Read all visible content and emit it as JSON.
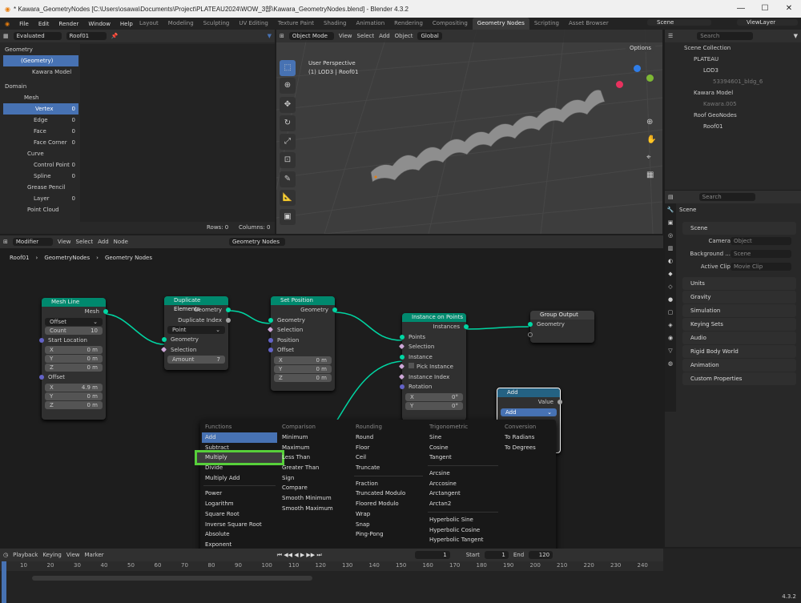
{
  "window": {
    "title": "* Kawara_GeometryNodes [C:\\Users\\osawa\\Documents\\Project\\PLATEAU2024\\WOW_3部\\Kawara_GeometryNodes.blend] - Blender 4.3.2"
  },
  "menubar": {
    "items": [
      "File",
      "Edit",
      "Render",
      "Window",
      "Help"
    ],
    "tabs": [
      "Layout",
      "Modeling",
      "Sculpting",
      "UV Editing",
      "Texture Paint",
      "Shading",
      "Animation",
      "Rendering",
      "Compositing",
      "Geometry Nodes",
      "Scripting",
      "Asset Browser"
    ],
    "scene": "Scene",
    "viewlayer": "ViewLayer"
  },
  "spreadsheet": {
    "mode": "Evaluated",
    "object": "Roof01",
    "geometry_header": "Geometry",
    "geometry": "(Geometry)",
    "kawara": "Kawara Model",
    "domain_header": "Domain",
    "mesh": "Mesh",
    "vertex": "Vertex",
    "edge": "Edge",
    "face": "Face",
    "face_corner": "Face Corner",
    "curve": "Curve",
    "control_point": "Control Point",
    "spline": "Spline",
    "grease": "Grease Pencil",
    "layer": "Layer",
    "pointcloud": "Point Cloud",
    "zero": "0",
    "rows": "Rows: 0",
    "cols": "Columns: 0"
  },
  "viewport": {
    "mode": "Object Mode",
    "menus": [
      "View",
      "Select",
      "Add",
      "Object"
    ],
    "transform": "Global",
    "options": "Options",
    "persp": "User Perspective",
    "sub": "(1) LOD3 | Roof01"
  },
  "outliner": {
    "search": "Search",
    "collection": "Scene Collection",
    "plateau": "PLATEAU",
    "lod3": "LOD3",
    "bldg": "53394601_bldg_6",
    "kawara": "Kawara Model",
    "kawara005": "Kawara.005",
    "roofgeo": "Roof GeoNodes",
    "roof01": "Roof01"
  },
  "props": {
    "search": "Search",
    "title": "Scene",
    "section": "Scene",
    "camera_label": "Camera",
    "camera": "Object",
    "bg_label": "Background ...",
    "bg": "Scene",
    "clip_label": "Active Clip",
    "clip": "Movie Clip",
    "panels": [
      "Units",
      "Gravity",
      "Simulation",
      "Keying Sets",
      "Audio",
      "Rigid Body World",
      "Animation",
      "Custom Properties"
    ]
  },
  "node_editor": {
    "mode": "Modifier",
    "menus": [
      "View",
      "Select",
      "Add",
      "Node"
    ],
    "tree": "Geometry Nodes",
    "bc1": "Roof01",
    "bc2": "GeometryNodes",
    "bc3": "Geometry Nodes"
  },
  "nodes": {
    "meshline": {
      "title": "Mesh Line",
      "out": "Mesh",
      "mode": "Offset",
      "count_l": "Count",
      "count": "10",
      "start": "Start Location",
      "x": "X",
      "y": "Y",
      "z": "Z",
      "zm": "0 m",
      "offset": "Offset",
      "ox": "4.9 m"
    },
    "dup": {
      "title": "Duplicate Elements",
      "geo": "Geometry",
      "idx": "Duplicate Index",
      "domain": "Point",
      "sel": "Selection",
      "amt_l": "Amount",
      "amt": "7"
    },
    "setpos": {
      "title": "Set Position",
      "geo": "Geometry",
      "sel": "Selection",
      "pos": "Position",
      "off": "Offset",
      "zm": "0 m"
    },
    "inst": {
      "title": "Instance on Points",
      "out": "Instances",
      "pts": "Points",
      "sel": "Selection",
      "inst": "Instance",
      "pick": "Pick Instance",
      "idx": "Instance Index",
      "rot": "Rotation",
      "deg": "0°",
      "x": "X",
      "y": "Y"
    },
    "group": {
      "title": "Group Output",
      "geo": "Geometry"
    },
    "add": {
      "title": "Add",
      "value": "Value",
      "op": "Add"
    }
  },
  "menu": {
    "functions": {
      "h": "Functions",
      "items": [
        "Add",
        "Subtract",
        "Multiply",
        "Divide",
        "Multiply Add",
        "Power",
        "Logarithm",
        "Square Root",
        "Inverse Square Root",
        "Absolute",
        "Exponent"
      ]
    },
    "comparison": {
      "h": "Comparison",
      "items": [
        "Minimum",
        "Maximum",
        "Less Than",
        "Greater Than",
        "Sign",
        "Compare",
        "Smooth Minimum",
        "Smooth Maximum"
      ]
    },
    "rounding": {
      "h": "Rounding",
      "items": [
        "Round",
        "Floor",
        "Ceil",
        "Truncate",
        "Fraction",
        "Truncated Modulo",
        "Floored Modulo",
        "Wrap",
        "Snap",
        "Ping-Pong"
      ]
    },
    "trig": {
      "h": "Trigonometric",
      "items": [
        "Sine",
        "Cosine",
        "Tangent",
        "Arcsine",
        "Arccosine",
        "Arctangent",
        "Arctan2",
        "Hyperbolic Sine",
        "Hyperbolic Cosine",
        "Hyperbolic Tangent"
      ]
    },
    "conv": {
      "h": "Conversion",
      "items": [
        "To Radians",
        "To Degrees"
      ]
    }
  },
  "timeline": {
    "menus": [
      "Playback",
      "Keying",
      "View",
      "Marker"
    ],
    "frame": "1",
    "start_l": "Start",
    "start": "1",
    "end_l": "End",
    "end": "120",
    "ticks": [
      "10",
      "20",
      "30",
      "40",
      "50",
      "60",
      "70",
      "80",
      "90",
      "100",
      "110",
      "120",
      "130",
      "140",
      "150",
      "160",
      "170",
      "180",
      "190",
      "200",
      "210",
      "220",
      "230",
      "240"
    ],
    "version": "4.3.2"
  },
  "colors": {
    "accent": "#4772b3",
    "highlight": "#57d03a",
    "geo_socket": "#00d6a3"
  }
}
